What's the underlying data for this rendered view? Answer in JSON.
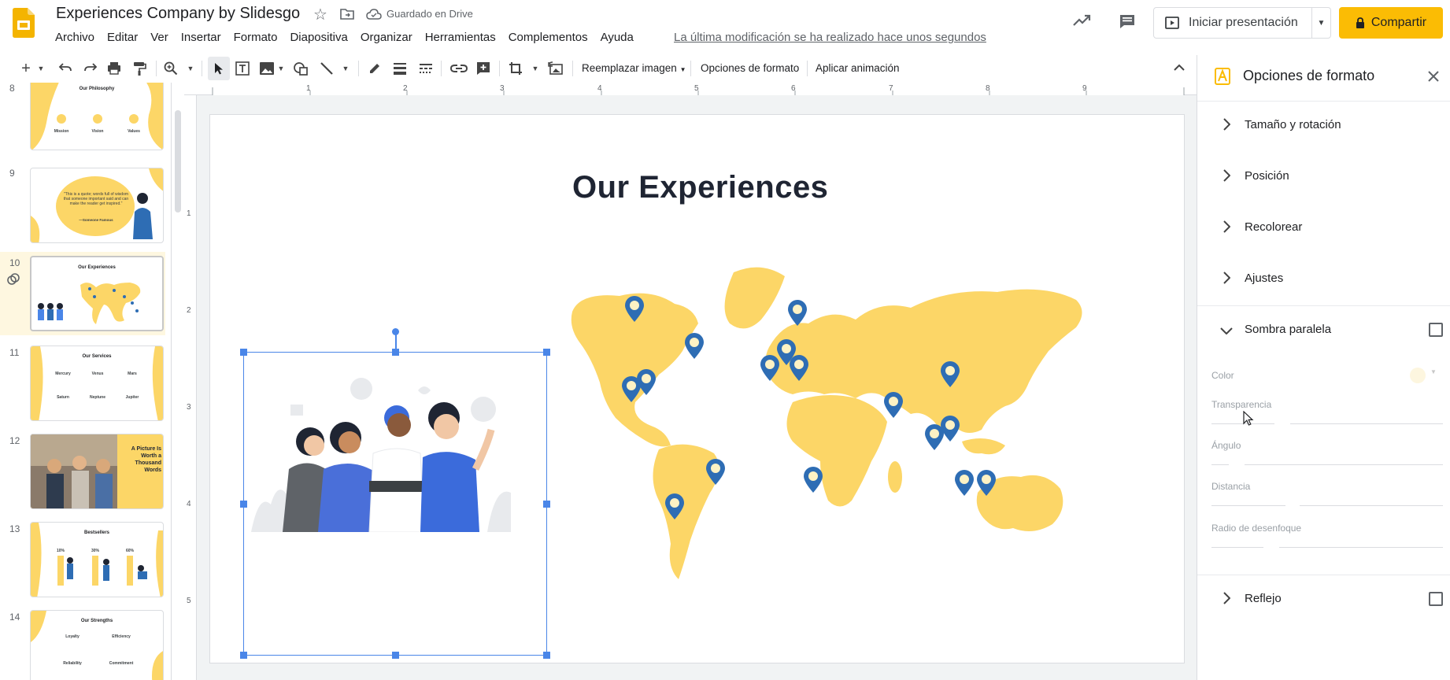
{
  "header": {
    "doc_title": "Experiences Company by Slidesgo",
    "saved_status": "Guardado en Drive",
    "last_edit": "La última modificación se ha realizado hace unos segundos",
    "present_label": "Iniciar presentación",
    "share_label": "Compartir",
    "brand_color": "#fbbc04"
  },
  "menu": [
    "Archivo",
    "Editar",
    "Ver",
    "Insertar",
    "Formato",
    "Diapositiva",
    "Organizar",
    "Herramientas",
    "Complementos",
    "Ayuda"
  ],
  "toolbar": {
    "replace_image": "Reemplazar imagen",
    "format_options": "Opciones de formato",
    "apply_animation": "Aplicar animación"
  },
  "filmstrip": {
    "slides": [
      {
        "num": "8",
        "title": "Our Philosophy",
        "labels": [
          "Mission",
          "Vision",
          "Values"
        ]
      },
      {
        "num": "9",
        "title": "",
        "quote": "\"This is a quote; words full of wisdom that someone important said and can make the reader get inspired.\"",
        "author": "—Someone Famous"
      },
      {
        "num": "10",
        "title": "Our Experiences"
      },
      {
        "num": "11",
        "title": "Our Services",
        "labels": [
          "Mercury",
          "Venus",
          "Mars",
          "Saturn",
          "Neptune",
          "Jupiter"
        ]
      },
      {
        "num": "12",
        "title": "A Picture Is Worth a Thousand Words"
      },
      {
        "num": "13",
        "title": "Bestsellers",
        "labels": [
          "10%",
          "30%",
          "60%"
        ]
      },
      {
        "num": "14",
        "title": "Our Strengths",
        "labels": [
          "Loyalty",
          "Efficiency",
          "Reliability",
          "Commitment"
        ]
      }
    ]
  },
  "ruler": {
    "top": [
      "1",
      "2",
      "3",
      "4",
      "5",
      "6",
      "7",
      "8",
      "9"
    ],
    "left": [
      "1",
      "2",
      "3",
      "4",
      "5"
    ]
  },
  "slide": {
    "title": "Our Experiences",
    "map_color": "#fcd667",
    "pin_color": "#2e6db4"
  },
  "format_panel": {
    "title": "Opciones de formato",
    "sections": {
      "size": "Tamaño y rotación",
      "position": "Posición",
      "recolor": "Recolorear",
      "adjust": "Ajustes",
      "shadow": "Sombra paralela",
      "reflection": "Reflejo"
    },
    "shadow_fields": {
      "color": "Color",
      "transparency": "Transparencia",
      "angle": "Ángulo",
      "distance": "Distancia",
      "blur": "Radio de desenfoque"
    }
  }
}
